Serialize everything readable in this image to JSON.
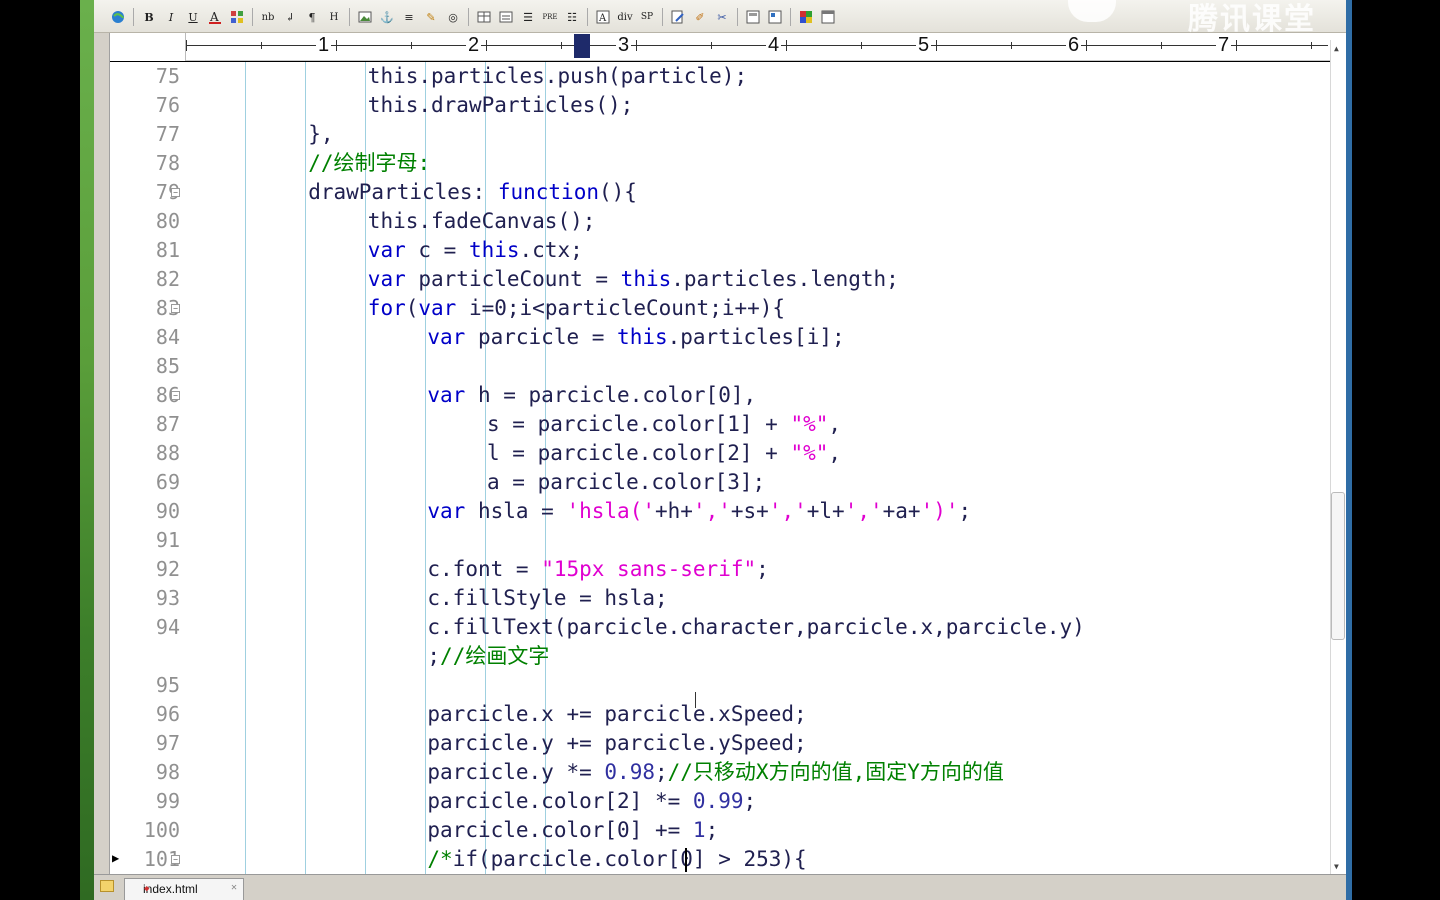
{
  "app": {
    "open_tab": "index.html"
  },
  "ruler": {
    "numbers": [
      "1",
      "2",
      "3",
      "4",
      "5",
      "6",
      "7"
    ]
  },
  "toolbar": {
    "buttons": [
      "globe-icon",
      "bold-icon",
      "italic-icon",
      "underline-icon",
      "font-color-icon",
      "table-color-icon",
      "nbsp-icon",
      "line-break-icon",
      "paragraph-icon",
      "heading-icon",
      "image-icon",
      "anchor-icon",
      "hr-icon",
      "marker-icon",
      "spell-icon",
      "table-icon",
      "form-icon",
      "align-icon",
      "pre-icon",
      "list-icon",
      "font-icon",
      "div-icon",
      "span-icon",
      "edit-icon",
      "brush-icon",
      "scissors-icon",
      "frame-icon",
      "grid-icon",
      "color-picker-icon",
      "window-icon"
    ],
    "labels": {
      "bold": "B",
      "italic": "I",
      "underline": "U",
      "nbsp": "nb",
      "heading": "H",
      "pre": "PRE",
      "div": "div",
      "span": "SP"
    }
  },
  "watermark": "腾讯课堂",
  "code_lines": [
    {
      "n": "75",
      "indent": 6,
      "tokens": [
        [
          "pl",
          "this.particles.push(particle);"
        ]
      ]
    },
    {
      "n": "76",
      "indent": 6,
      "tokens": [
        [
          "pl",
          "this.drawParticles();"
        ]
      ]
    },
    {
      "n": "77",
      "indent": 4,
      "tokens": [
        [
          "pl",
          "},"
        ]
      ]
    },
    {
      "n": "78",
      "indent": 4,
      "tokens": [
        [
          "cm",
          "//绘制字母:"
        ]
      ]
    },
    {
      "n": "79",
      "indent": 4,
      "fold": true,
      "tokens": [
        [
          "pl",
          "drawParticles: "
        ],
        [
          "kw",
          "function"
        ],
        [
          "pl",
          "(){"
        ]
      ]
    },
    {
      "n": "80",
      "indent": 6,
      "tokens": [
        [
          "pl",
          "this.fadeCanvas();"
        ]
      ]
    },
    {
      "n": "81",
      "indent": 6,
      "tokens": [
        [
          "kw",
          "var"
        ],
        [
          "pl",
          " c = "
        ],
        [
          "kw",
          "this"
        ],
        [
          "pl",
          ".ctx;"
        ]
      ]
    },
    {
      "n": "82",
      "indent": 6,
      "tokens": [
        [
          "kw",
          "var"
        ],
        [
          "pl",
          " particleCount = "
        ],
        [
          "kw",
          "this"
        ],
        [
          "pl",
          ".particles.length;"
        ]
      ]
    },
    {
      "n": "83",
      "indent": 6,
      "fold": true,
      "tokens": [
        [
          "kw",
          "for"
        ],
        [
          "pl",
          "("
        ],
        [
          "kw",
          "var"
        ],
        [
          "pl",
          " i=0;i<particleCount;i++){"
        ]
      ]
    },
    {
      "n": "84",
      "indent": 8,
      "tokens": [
        [
          "kw",
          "var"
        ],
        [
          "pl",
          " parcicle = "
        ],
        [
          "kw",
          "this"
        ],
        [
          "pl",
          ".particles[i];"
        ]
      ]
    },
    {
      "n": "85",
      "indent": 8,
      "tokens": []
    },
    {
      "n": "86",
      "indent": 8,
      "fold": true,
      "tokens": [
        [
          "kw",
          "var"
        ],
        [
          "pl",
          " h = parcicle.color[0],"
        ]
      ]
    },
    {
      "n": "87",
      "indent": 10,
      "tokens": [
        [
          "pl",
          "s = parcicle.color[1] + "
        ],
        [
          "st",
          "\"%\""
        ],
        [
          "pl",
          ","
        ]
      ]
    },
    {
      "n": "88",
      "indent": 10,
      "tokens": [
        [
          "pl",
          "l = parcicle.color[2] + "
        ],
        [
          "st",
          "\"%\""
        ],
        [
          "pl",
          ","
        ]
      ]
    },
    {
      "n": "69",
      "indent": 10,
      "tokens": [
        [
          "pl",
          "a = parcicle.color[3];"
        ]
      ]
    },
    {
      "n": "90",
      "indent": 8,
      "tokens": [
        [
          "kw",
          "var"
        ],
        [
          "pl",
          " hsla = "
        ],
        [
          "st",
          "'hsla('"
        ],
        [
          "pl",
          "+h+"
        ],
        [
          "st",
          "','"
        ],
        [
          "pl",
          "+s+"
        ],
        [
          "st",
          "','"
        ],
        [
          "pl",
          "+l+"
        ],
        [
          "st",
          "','"
        ],
        [
          "pl",
          "+a+"
        ],
        [
          "st",
          "')'"
        ],
        [
          "pl",
          ";"
        ]
      ]
    },
    {
      "n": "91",
      "indent": 8,
      "tokens": []
    },
    {
      "n": "92",
      "indent": 8,
      "tokens": [
        [
          "pl",
          "c.font = "
        ],
        [
          "st",
          "\"15px sans-serif\""
        ],
        [
          "pl",
          ";"
        ]
      ]
    },
    {
      "n": "93",
      "indent": 8,
      "tokens": [
        [
          "pl",
          "c.fillStyle = hsla;"
        ]
      ]
    },
    {
      "n": "94",
      "indent": 8,
      "tokens": [
        [
          "pl",
          "c.fillText(parcicle.character,parcicle.x,parcicle.y)"
        ]
      ]
    },
    {
      "n": "",
      "indent": 8,
      "tokens": [
        [
          "pl",
          ";"
        ],
        [
          "cm",
          "//绘画文字"
        ]
      ]
    },
    {
      "n": "95",
      "indent": 8,
      "tokens": []
    },
    {
      "n": "96",
      "indent": 8,
      "tokens": [
        [
          "pl",
          "parcicle.x += parcicle.xSpeed;"
        ]
      ]
    },
    {
      "n": "97",
      "indent": 8,
      "tokens": [
        [
          "pl",
          "parcicle.y += parcicle.ySpeed;"
        ]
      ]
    },
    {
      "n": "98",
      "indent": 8,
      "tokens": [
        [
          "pl",
          "parcicle.y *= "
        ],
        [
          "nm",
          "0.98"
        ],
        [
          "pl",
          ";"
        ],
        [
          "cm",
          "//只移动X方向的值,固定Y方向的值"
        ]
      ]
    },
    {
      "n": "99",
      "indent": 8,
      "tokens": [
        [
          "pl",
          "parcicle.color[2] *= "
        ],
        [
          "nm",
          "0.99"
        ],
        [
          "pl",
          ";"
        ]
      ]
    },
    {
      "n": "100",
      "indent": 8,
      "tokens": [
        [
          "pl",
          "parcicle.color[0] += "
        ],
        [
          "nm",
          "1"
        ],
        [
          "pl",
          ";"
        ]
      ]
    },
    {
      "n": "101",
      "indent": 8,
      "fold": true,
      "current": true,
      "tokens": [
        [
          "cm",
          "/*"
        ],
        [
          "pl",
          "if(parcicle.color[0] > 253){"
        ]
      ]
    }
  ],
  "colors": {
    "keyword": "#0000c8",
    "plain": "#202050",
    "comment": "#008000",
    "string": "#e000d0",
    "number": "#3030a0",
    "line_number": "#909090",
    "indent_guide": "#9fd0e0"
  }
}
